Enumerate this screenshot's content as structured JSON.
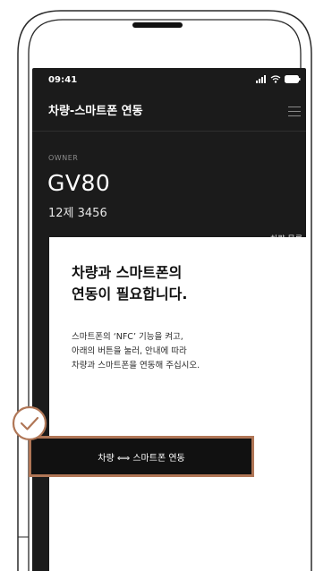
{
  "status_bar": {
    "time": "09:41",
    "icons": [
      "signal-icon",
      "wifi-icon",
      "battery-icon"
    ]
  },
  "header": {
    "title": "차량-스마트폰 연동",
    "menu_icon": "hamburger-menu-icon"
  },
  "vehicle": {
    "owner_label": "OWNER",
    "model": "GV80",
    "plate": "12제 3456"
  },
  "vehicle_list_link": "차량 목록",
  "card": {
    "title_lines": [
      "차량과 스마트폰의",
      "연동이 필요합니다."
    ],
    "description_lines": [
      "스마트폰의 ‘NFC’ 기능을 켜고,",
      "아래의 버튼을 눌러, 안내에 따라",
      "차량과 스마트폰을 연동해 주십시오."
    ]
  },
  "pair_button": {
    "label": "차량 ⟺ 스마트폰 연동"
  },
  "colors": {
    "screen_background": "#1b1b1b",
    "accent": "#b07656",
    "card_background": "#ffffff",
    "button_background": "#111111"
  }
}
